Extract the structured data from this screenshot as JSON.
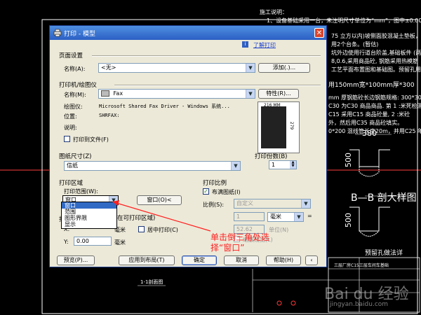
{
  "cad": {
    "heading": "施工说明：",
    "line1": "1、设备基础采用一台，未注明尺寸单位为“mm”，图中±0.000 对",
    "lines": [
      "75 立方以内)坡侧面胶混凝土垫板，沿...",
      "用2个台条。(暂估)",
      "坑外边使用行道台阶盖,基础板件 (两钢筋上",
      "8,0.6,采用商品砼, 钢筋采用热模筋",
      "工艺平面布置图和基础图。预留孔用钢"
    ],
    "line_depth": "用150mm宽*100mm厚*300",
    "lines2": [
      "mm 厚钢筋砼长边钢筋规格: 300*300",
      "C30 为C30 商品商品. 第 1 :米死检测检测",
      "C15 采用C15 商品砼量, 2 :米砼",
      "外，然后用C35 商品砼填实。",
      "0*200 混线管长度20m，并用C25 年"
    ],
    "dim_380": "380",
    "dim_500a": "500",
    "dim_500b": "500",
    "section_title": "B—B 剖大样图",
    "section_table_title": "预留孔做法详",
    "bottom_label": "1-1剖面图",
    "table_text": "三层厂房C15三层车间车基础"
  },
  "dialog": {
    "title": "打印 - 模型",
    "help_link": "了解打印",
    "page_setup": {
      "heading": "页面设置",
      "name_label": "名称(A):",
      "name_value": "<无>",
      "add_button": "添加(.)..."
    },
    "printer": {
      "heading": "打印机/绘图仪",
      "name_label": "名称(M):",
      "name_value": "Fax",
      "properties_button": "特性(R)...",
      "plotter_label": "绘图仪:",
      "plotter_value": "Microsoft Shared Fax Driver - Windows 系统...",
      "location_label": "位置:",
      "location_value": "SHRFAX:",
      "description_label": "说明:",
      "print_to_file": "打印到文件(F)",
      "preview_width": "216 MM",
      "preview_height": "279"
    },
    "paper": {
      "heading": "图纸尺寸(Z)",
      "value": "信纸"
    },
    "copies": {
      "heading": "打印份数(B)",
      "value": "1"
    },
    "area": {
      "heading": "打印区域",
      "range_label": "打印范围(W):",
      "range_value": "窗口",
      "window_button": "窗口(O)<",
      "dropdown_options": [
        "窗口",
        "范围",
        "图形界限",
        "显示"
      ],
      "offset_heading_suffix": "在可打印区域)",
      "offset_prefix": "打",
      "x_label": "X:",
      "y_label": "Y:",
      "y_value": "0.00",
      "unit_mm": "毫米",
      "center_label": "居中打印(C)"
    },
    "scale": {
      "heading": "打印比例",
      "fit_label": "布满图纸(I)",
      "scale_label": "比例(S):",
      "scale_value": "自定义",
      "value1": "1",
      "unit1": "毫米",
      "equals": "=",
      "value2": "52.62",
      "unit2": "单位(N)",
      "lineweight": "缩放线宽(L)"
    },
    "buttons": {
      "preview": "预览(P)...",
      "apply_layout": "应用到布局(T)",
      "ok": "确定",
      "cancel": "取消",
      "help": "帮助(H)"
    }
  },
  "annotation": {
    "line1": "单击倒三角处选",
    "line2": "择“窗口”"
  },
  "watermark": {
    "brand": "Bai du 经验",
    "url": "jingyan.baidu.com"
  },
  "colors": {
    "accent": "#316ac5",
    "annotation": "#ff2020",
    "cad_red": "#ff3b3b"
  }
}
